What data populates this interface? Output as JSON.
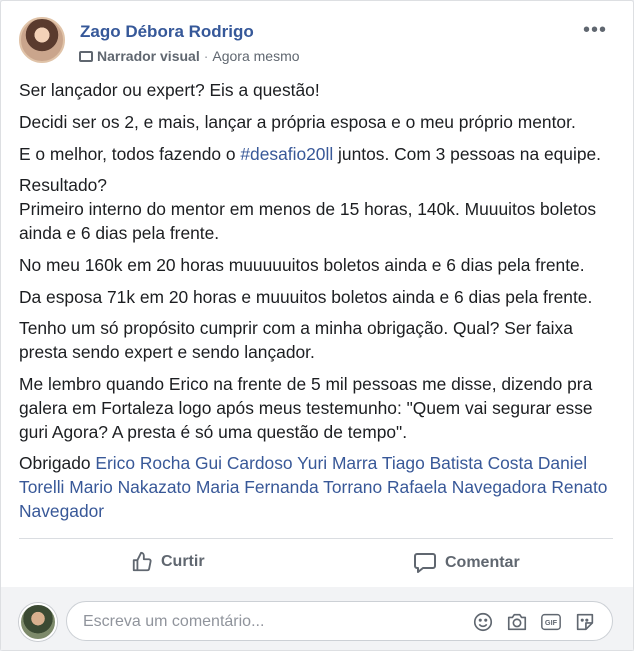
{
  "post": {
    "author": "Zago Débora Rodrigo",
    "badge_label": "Narrador visual",
    "separator": "·",
    "time": "Agora mesmo",
    "menu_icon": "more-horizontal-icon",
    "paragraphs": [
      "Ser lançador ou expert? Eis a questão!",
      "Decidi ser os 2, e mais, lançar a própria esposa e o meu próprio mentor."
    ],
    "p3": {
      "before": "E o melhor, todos fazendo o ",
      "hashtag": "#desafio20ll",
      "after": " juntos. Com 3 pessoas na equipe."
    },
    "p4_line1": "Resultado?",
    "p4_line2": "Primeiro interno do mentor em menos de 15 horas, 140k. Muuuitos boletos ainda e 6 dias pela frente.",
    "p5": "No meu 160k em 20 horas muuuuuitos boletos ainda e 6 dias pela frente.",
    "p6": "Da esposa 71k em 20 horas e muuuitos boletos ainda e 6 dias pela frente.",
    "p7": "Tenho um só propósito cumprir com a minha obrigação. Qual? Ser faixa presta sendo expert e sendo lançador.",
    "p8": "Me lembro quando Erico na frente de 5 mil pessoas me disse, dizendo pra galera em Fortaleza logo após meus testemunho: \"Quem vai segurar esse guri Agora? A presta é só uma questão de tempo\".",
    "thanks_word": "Obrigado",
    "tags": [
      "Erico Rocha",
      "Gui Cardoso",
      "Yuri Marra",
      "Tiago Batista Costa",
      "Daniel Torelli",
      "Mario Nakazato",
      "Maria Fernanda Torrano",
      "Rafaela Navegadora",
      "Renato Navegador"
    ]
  },
  "actions": {
    "like_label": "Curtir",
    "comment_label": "Comentar"
  },
  "comment_box": {
    "placeholder": "Escreva um comentário...",
    "tools": [
      "emoji-icon",
      "camera-icon",
      "gif-icon",
      "sticker-icon"
    ]
  },
  "colors": {
    "link": "#385898",
    "author": "#365899",
    "muted": "#606770"
  }
}
